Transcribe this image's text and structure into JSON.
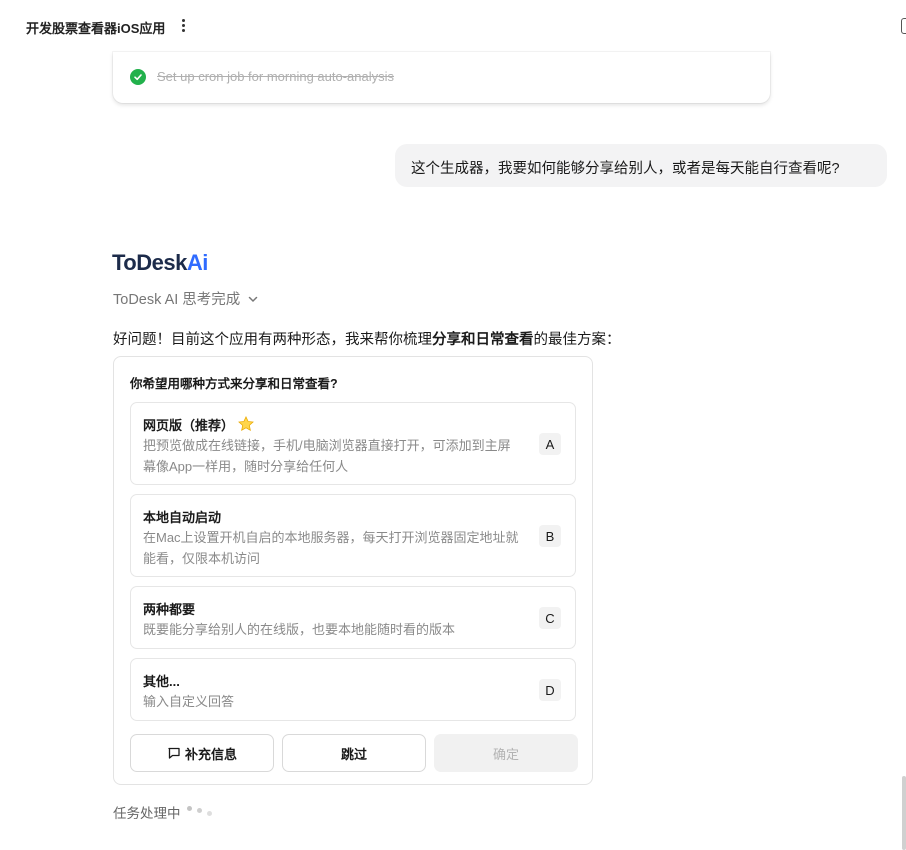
{
  "header": {
    "title": "开发股票查看器iOS应用"
  },
  "completed_task": {
    "text": "Set up cron job for morning auto-analysis"
  },
  "user_message": {
    "text": "这个生成器，我要如何能够分享给别人，或者是每天能自行查看呢?"
  },
  "assistant": {
    "brand_main": "ToDesk",
    "brand_ai": "Ai",
    "think_status": "ToDesk AI 思考完成",
    "intro_pre": "好问题！目前这个应用有两种形态，我来帮你梳理",
    "intro_bold": "分享和日常查看",
    "intro_post": "的最佳方案："
  },
  "question": {
    "title": "你希望用哪种方式来分享和日常查看?",
    "options": [
      {
        "title": "网页版（推荐）",
        "desc": "把预览做成在线链接，手机/电脑浏览器直接打开，可添加到主屏幕像App一样用，随时分享给任何人",
        "letter": "A"
      },
      {
        "title": "本地自动启动",
        "desc": "在Mac上设置开机自启的本地服务器，每天打开浏览器固定地址就能看，仅限本机访问",
        "letter": "B"
      },
      {
        "title": "两种都要",
        "desc": "既要能分享给别人的在线版，也要本地能随时看的版本",
        "letter": "C"
      },
      {
        "title": "其他...",
        "desc": "输入自定义回答",
        "letter": "D"
      }
    ],
    "buttons": {
      "supplement": "补充信息",
      "skip": "跳过",
      "confirm": "确定"
    }
  },
  "status": {
    "text": "任务处理中"
  },
  "colors": {
    "check_green": "#22b14c",
    "brand_blue": "#2f6bff",
    "brand_navy": "#1c2b4a",
    "bubble_bg": "#f3f3f4"
  },
  "icons": [
    "more-vertical-icon",
    "sidebar-panel-icon",
    "check-circle-icon",
    "chevron-down-icon",
    "star-icon",
    "chat-bubble-icon",
    "loading-dots-icon"
  ]
}
